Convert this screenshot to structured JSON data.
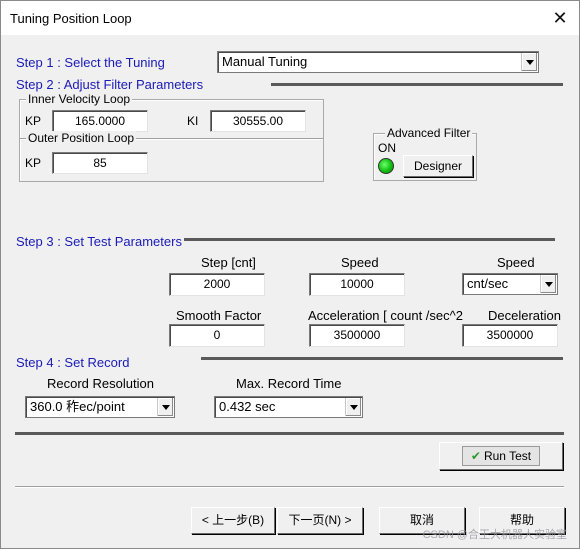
{
  "window": {
    "title": "Tuning Position Loop"
  },
  "step1": {
    "label": "Step 1 : Select the  Tuning",
    "combo_value": "Manual Tuning"
  },
  "step2": {
    "label": "Step 2 :  Adjust Filter Parameters",
    "inner_group": "Inner Velocity Loop",
    "kp_label": "KP",
    "kp_value": "165.0000",
    "ki_label": "KI",
    "ki_value": "30555.00",
    "outer_group": "Outer Position Loop",
    "outer_kp_label": "KP",
    "outer_kp_value": "85",
    "advanced_group": "Advanced Filter",
    "on_label": "ON",
    "designer_label": "Designer"
  },
  "step3": {
    "label": "Step 3 : Set Test  Parameters",
    "step_label": "Step [cnt]",
    "step_value": "2000",
    "speed_label": "Speed",
    "speed_value": "10000",
    "speed_unit_label": "Speed",
    "speed_unit_value": "cnt/sec",
    "smooth_label": "Smooth Factor",
    "smooth_value": "0",
    "accel_label": "Acceleration   [ count /sec^2",
    "accel_value": "3500000",
    "decel_label": "Deceleration",
    "decel_value": "3500000"
  },
  "step4": {
    "label": "Step 4 : Set Record",
    "resolution_label": "Record Resolution",
    "resolution_value": "360.0 秨ec/point",
    "max_time_label": "Max. Record Time",
    "max_time_value": "0.432 sec"
  },
  "run_test": {
    "label": "Run Test"
  },
  "nav": {
    "back": "< 上一步(B)",
    "next": "下一页(N) >",
    "cancel": "取消",
    "help": "帮助"
  },
  "watermark": "CSDN @合王大机器人实验室",
  "icons": {
    "close": "close-icon",
    "led": "led-on-icon",
    "check": "check-icon"
  },
  "colors": {
    "step_label": "#1a1ab8",
    "led_on": "#10c010",
    "background": "#f0f0f0"
  }
}
